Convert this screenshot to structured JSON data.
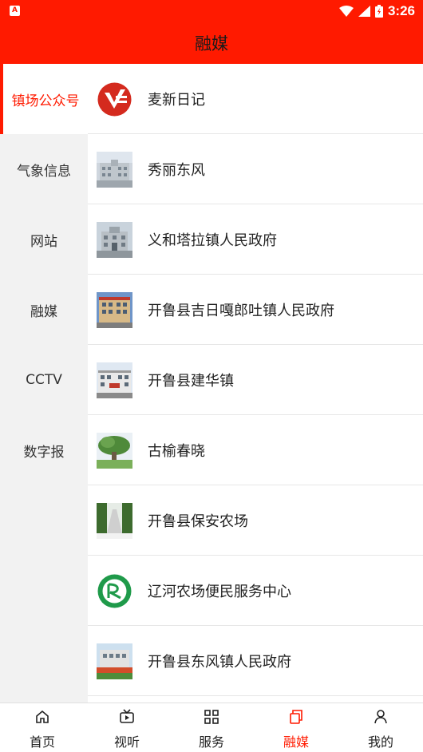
{
  "status_bar": {
    "time": "3:26",
    "left_icon_text": "A"
  },
  "header": {
    "title": "融媒"
  },
  "colors": {
    "accent": "#ff1a00"
  },
  "sidebar": {
    "items": [
      {
        "label": "镇场公众号",
        "active": true
      },
      {
        "label": "气象信息"
      },
      {
        "label": "网站"
      },
      {
        "label": "融媒"
      },
      {
        "label": "CCTV"
      },
      {
        "label": "数字报"
      }
    ]
  },
  "list": {
    "items": [
      {
        "label": "麦新日记",
        "icon": "maixin-logo"
      },
      {
        "label": "秀丽东风",
        "icon": "building-photo"
      },
      {
        "label": "义和塔拉镇人民政府",
        "icon": "building-photo"
      },
      {
        "label": "开鲁县吉日嘎郎吐镇人民政府",
        "icon": "building-photo"
      },
      {
        "label": "开鲁县建华镇",
        "icon": "building-photo"
      },
      {
        "label": "古榆春晓",
        "icon": "tree-photo"
      },
      {
        "label": "开鲁县保安农场",
        "icon": "road-photo"
      },
      {
        "label": "辽河农场便民服务中心",
        "icon": "green-seal-logo"
      },
      {
        "label": "开鲁县东风镇人民政府",
        "icon": "building-photo"
      }
    ]
  },
  "bottom_nav": {
    "items": [
      {
        "label": "首页",
        "icon": "home-icon"
      },
      {
        "label": "视听",
        "icon": "tv-icon"
      },
      {
        "label": "服务",
        "icon": "grid-icon"
      },
      {
        "label": "融媒",
        "icon": "media-icon",
        "active": true
      },
      {
        "label": "我的",
        "icon": "user-icon"
      }
    ]
  }
}
